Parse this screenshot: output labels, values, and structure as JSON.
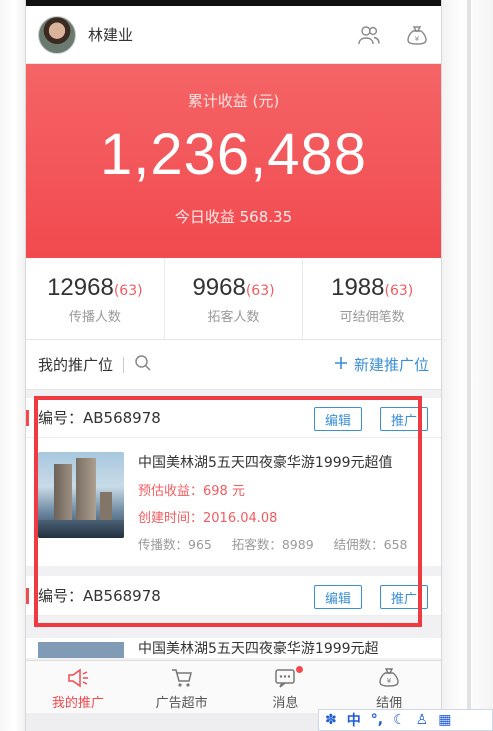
{
  "user": {
    "name": "林建业"
  },
  "earnings": {
    "title": "累计收益 (元)",
    "total": "1,236,488",
    "today_label": "今日收益 568.35"
  },
  "stats": [
    {
      "value": "12968",
      "delta": "(63)",
      "label": "传播人数"
    },
    {
      "value": "9968",
      "delta": "(63)",
      "label": "拓客人数"
    },
    {
      "value": "1988",
      "delta": "(63)",
      "label": "可结佣笔数"
    }
  ],
  "toolbar": {
    "title": "我的推广位",
    "new_button": "新建推广位"
  },
  "cards": [
    {
      "code": "编号：AB568978",
      "edit": "编辑",
      "promote": "推广",
      "title": "中国美林湖5五天四夜豪华游1999元超值",
      "est": "预估收益：698 元",
      "created": "创建时间：2016.04.08",
      "spread": "传播数：965",
      "leads": "拓客数：8989",
      "commission": "结佣数：658"
    },
    {
      "code": "编号：AB568978",
      "edit": "编辑",
      "promote": "推广"
    }
  ],
  "peek_title": "中国美林湖5五天四夜豪华游1999元超",
  "tabs": [
    {
      "label": "我的推广",
      "icon": "megaphone-icon",
      "active": true
    },
    {
      "label": "广告超市",
      "icon": "cart-icon",
      "active": false
    },
    {
      "label": "消息",
      "icon": "message-icon",
      "active": false,
      "badge": true
    },
    {
      "label": "结佣",
      "icon": "money-bag-icon",
      "active": false
    }
  ],
  "ime": {
    "mode": "中"
  },
  "colors": {
    "accent": "#f24a4f",
    "link": "#3a8fd6"
  }
}
